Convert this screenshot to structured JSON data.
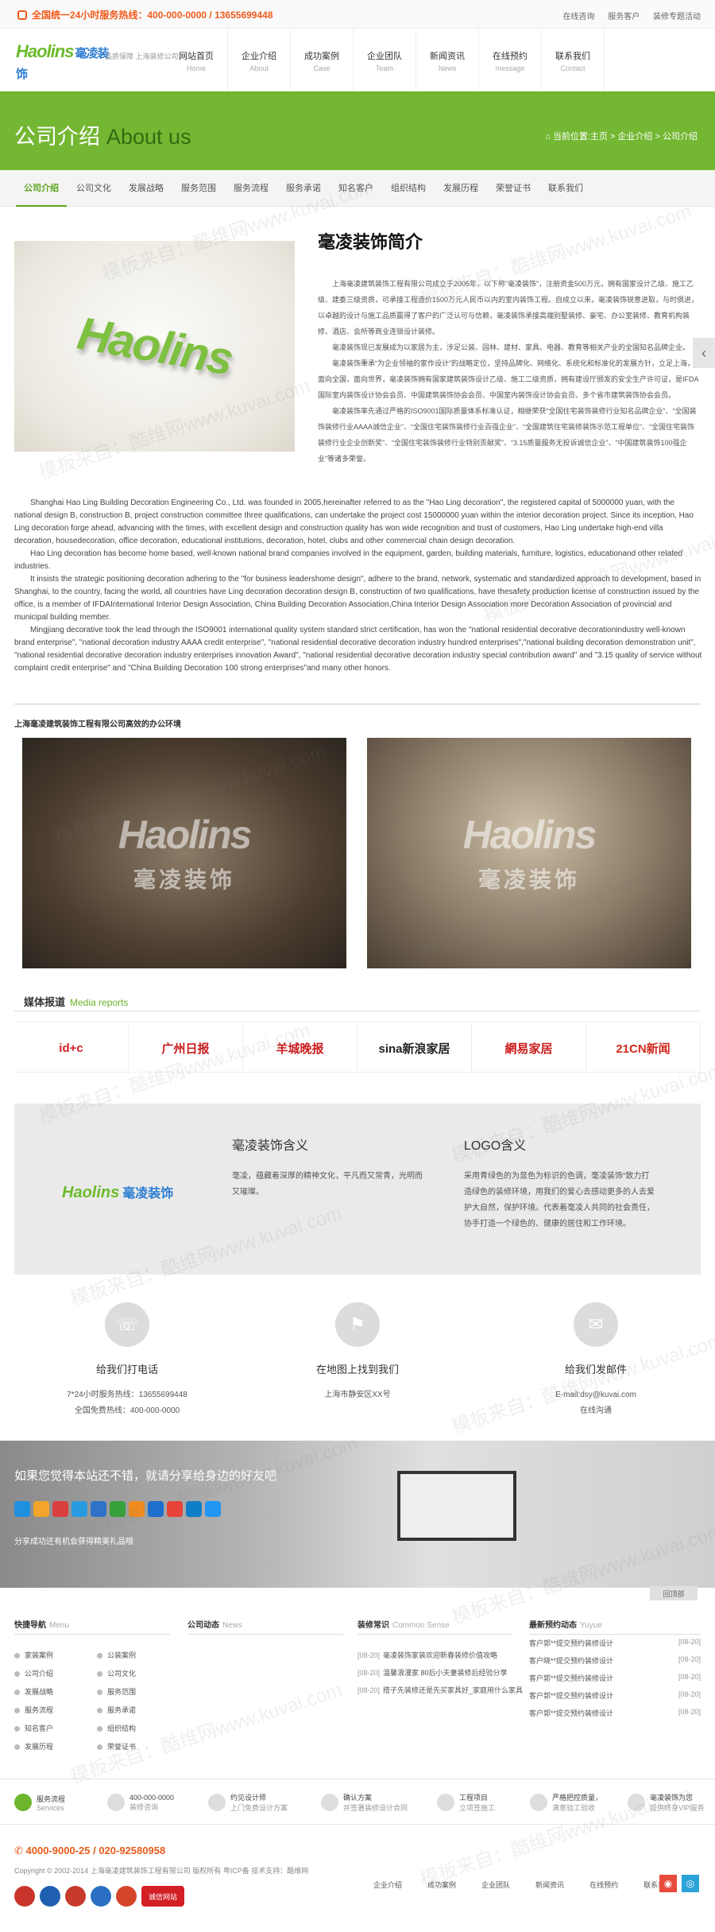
{
  "topbar": {
    "hotline": "全国统一24小时服务热线：400-000-0000 / 13655699448",
    "links": [
      "在线咨询",
      "服务客户",
      "装修专题活动"
    ]
  },
  "header": {
    "logo_en": "Haolins",
    "logo_cn": "毫凌装饰",
    "logo_tag": "品质保障 上海装修公司",
    "nav": [
      {
        "cn": "网站首页",
        "en": "Home"
      },
      {
        "cn": "企业介绍",
        "en": "About"
      },
      {
        "cn": "成功案例",
        "en": "Case"
      },
      {
        "cn": "企业团队",
        "en": "Team"
      },
      {
        "cn": "新闻资讯",
        "en": "News"
      },
      {
        "cn": "在线预约",
        "en": "message"
      },
      {
        "cn": "联系我们",
        "en": "Contact"
      }
    ]
  },
  "banner": {
    "title_cn": "公司介绍",
    "title_en": "About us",
    "breadcrumb": "当前位置:主页 > 企业介绍 > 公司介绍"
  },
  "subnav": [
    "公司介绍",
    "公司文化",
    "发展战略",
    "服务范围",
    "服务流程",
    "服务承诺",
    "知名客户",
    "组织结构",
    "发展历程",
    "荣誉证书",
    "联系我们"
  ],
  "intro": {
    "title": "毫凌装饰简介",
    "cn_paragraphs": [
      "上海毫凌建筑装饰工程有限公司成立于2005年，以下称“毫凌装饰”，注册资金500万元，拥有国家设计乙级、施工乙级、建委三级资质，可承接工程造价1500万元人民币以内的室内装饰工程。自成立以来，毫凌装饰锐意进取，与时俱进，以卓越的设计与施工品质赢得了客户的广泛认可与信赖，毫凌装饰承接高端别墅装修、豪宅、办公室装修、教育机构装修、酒店、会所等商业连锁设计装修。",
      "毫凌装饰现已发展成为以家居为主，涉足公装、园林、建材、家具、电器、教育等相关产业的全国知名品牌企业。",
      "毫凌装饰秉承“为企业领袖的家作设计”的战略定位，坚持品牌化、网络化、系统化和标准化的发展方针，立足上海，面向全国，面向世界，毫凌装饰拥有国家建筑装饰设计乙级、施工二级资质，拥有建设厅颁发的安全生产许可证，是IFDA国际室内装饰设计协会会员、中国建筑装饰协会会员、中国室内装饰设计协会会员、多个省市建筑装饰协会会员。",
      "毫凌装饰率先通过严格的ISO9001国际质量体系标准认证，相继荣获“全国住宅装饰装修行业知名品牌企业”、“全国装饰装修行业AAAA诚信企业”、“全国住宅装饰装修行业百强企业”、“全国建筑住宅装修装饰示范工程单位”、“全国住宅装饰装修行业企业创新奖”、“全国住宅装饰装修行业特别贡献奖”、“3.15质量服务无投诉诚信企业”、“中国建筑装饰100强企业”等诸多荣誉。"
    ],
    "en_paragraphs": [
      "Shanghai Hao Ling Building Decoration Engineering Co., Ltd. was founded in 2005,hereinafter referred to as the \"Hao Ling decoration\", the registered capital of 5000000 yuan, with the national design B, construction B, project construction committee three qualifications, can undertake the project cost 15000000 yuan within the interior decoration project. Since its inception, Hao Ling decoration forge ahead, advancing with the times, with excellent design and construction quality has won wide recognition and trust of customers, Hao Ling undertake high-end villa decoration, housedecoration, office decoration, educational institutions, decoration, hotel, clubs and other commercial chain design decoration.",
      "Hao Ling decoration has become home based, well-known national brand companies involved in the equipment, garden, building materials, furniture, logistics, educationand other related industries.",
      "It insists the strategic positioning decoration adhering to the \"for business leadershome design\", adhere to the brand, network, systematic and standardized approach to development, based in Shanghai, to the country, facing the world, all countries have Ling decoration decoration design B, construction of two qualifications, have thesafety production license of construction issued by the office, is a member of IFDAInternational Interior Design Association, China Building Decoration Association,China Interior Design Association more Decoration Association of provincial and municipal building member.",
      "Mingjiang decorative took the lead through the ISO9001 international quality system standard strict certification, has won the \"national residential decorative decorationindustry well-known brand enterprise\", \"national decoration industry AAAA credit enterprise\", \"national residential decorative decoration industry hundred enterprises\",\"national building decoration demonstration unit\", \"national residential decorative decoration industry enterprises innovation Award\", \"national residential decorative decoration industry special contribution award\" and \"3.15 quality of service without complaint credit enterprise\" and \"China Building Decoration 100 strong enterprises\"and many other honors."
    ],
    "office_title": "上海毫凌建筑装饰工程有限公司高效的办公环境",
    "office_logo_en": "Haolins",
    "office_logo_cn": "毫凌装饰"
  },
  "media": {
    "title": "媒体报道",
    "title_en": "Media reports",
    "logos": [
      {
        "name": "id+c",
        "color": "#d21f24"
      },
      {
        "name": "广州日报",
        "color": "#c81c1c"
      },
      {
        "name": "羊城晚报",
        "color": "#c81c1c"
      },
      {
        "name": "sina新浪家居",
        "color": "#222222"
      },
      {
        "name": "網易家居",
        "color": "#cc1e1e"
      },
      {
        "name": "21CN新闻",
        "color": "#d12a1e"
      }
    ]
  },
  "meaning": {
    "logo_en": "Haolins",
    "logo_cn": "毫凌装饰",
    "m1_title": "毫凌装饰含义",
    "m1_text": "毫凌，蕴藏着深厚的精神文化，平凡而又常青，光明而又璀璨。",
    "m2_title": "LOGO含义",
    "m2_text": "采用青绿色的为显色为标识的色调，毫凌装饰“致力打造绿色的装修环境，用我们的爱心去感动更多的人去爱护大自然，保护环境。代表着毫凌人共同的社会责任，协手打造一个绿色的、健康的居住和工作环境。"
  },
  "contacts": [
    {
      "icon": "phone-icon",
      "glyph": "☏",
      "title": "给我们打电话",
      "lines": [
        "7*24小时服务热线：13655699448",
        "全国免费热线：400-000-0000"
      ]
    },
    {
      "icon": "map-pin-icon",
      "glyph": "⚑",
      "title": "在地图上找到我们",
      "lines": [
        "上海市静安区XX号"
      ]
    },
    {
      "icon": "mail-icon",
      "glyph": "✉",
      "title": "给我们发邮件",
      "lines": [
        "E-mail:dsy@kuvai.com",
        "在线沟通"
      ]
    }
  ],
  "share": {
    "title": "如果您觉得本站还不错，就请分享给身边的好友吧",
    "note": "分享成功还有机会获得精美礼品哦",
    "icons": [
      "#1f8fe0",
      "#f2a52a",
      "#d93e3e",
      "#2a9be0",
      "#2f72c8",
      "#37a03b",
      "#f08a1e",
      "#1a6fcf",
      "#e8443a",
      "#0d7ec8",
      "#2196f3"
    ]
  },
  "top_button": "回顶部",
  "footer": {
    "quick_nav": {
      "title": "快捷导航",
      "en": "Menu",
      "items": [
        "家装案例",
        "公装案例",
        "公司介绍",
        "公司文化",
        "发展战略",
        "服务范围",
        "服务流程",
        "服务承诺",
        "知名客户",
        "组织结构",
        "发展历程",
        "荣誉证书"
      ]
    },
    "news": {
      "title": "公司动态",
      "en": "News"
    },
    "common": {
      "title": "装修常识",
      "en": "Common Sense",
      "items": [
        {
          "date": "[08-20]",
          "text": "毫凌装饰家装欢迎新春装修价值攻略"
        },
        {
          "date": "[08-20]",
          "text": "温馨浪漫家 80后小夫妻装修后经验分享"
        },
        {
          "date": "[08-20]",
          "text": "搭子先装修还是先买家具好_家庭用什么家具"
        }
      ]
    },
    "orders": {
      "title": "最新预约动态",
      "en": "Yuyue",
      "items": [
        {
          "text": "客户郭**提交预约装修设计",
          "date": "[08-20]"
        },
        {
          "text": "客户晓**提交预约装修设计",
          "date": "[08-20]"
        },
        {
          "text": "客户郭**提交预约装修设计",
          "date": "[08-20]"
        },
        {
          "text": "客户郭**提交预约装修设计",
          "date": "[08-20]"
        },
        {
          "text": "客户郭**提交预约装修设计",
          "date": "[08-20]"
        }
      ]
    }
  },
  "services": [
    {
      "t1": "服务流程",
      "t2": "Services",
      "green": true
    },
    {
      "t1": "400-000-0000",
      "t2": "装修咨询",
      "green": false
    },
    {
      "t1": "约见设计师",
      "t2": "上门免费设计方案",
      "green": false
    },
    {
      "t1": "确认方案",
      "t2": "并签署装修设计合同",
      "green": false
    },
    {
      "t1": "工程项目",
      "t2": "立项签施工",
      "green": false
    },
    {
      "t1": "严格把控质量，",
      "t2": "满意验工验收",
      "green": false
    },
    {
      "t1": "毫凌装饰为您",
      "t2": "提供终身VIP服务",
      "green": false
    }
  ],
  "bottom": {
    "phone": "4000-9000-25 / 020-92580958",
    "copyright": "Copyright © 2002-2014 上海毫凌建筑装饰工程有限公司 版权所有 粤ICP备 技术支持：酷维网",
    "nav": [
      "企业介绍",
      "成功案例",
      "企业团队",
      "新闻资讯",
      "在线预约",
      "联系我们"
    ],
    "badge": "诚信网站"
  },
  "watermarks": [
    "模板来自：酷维网www.kuvai.com"
  ]
}
